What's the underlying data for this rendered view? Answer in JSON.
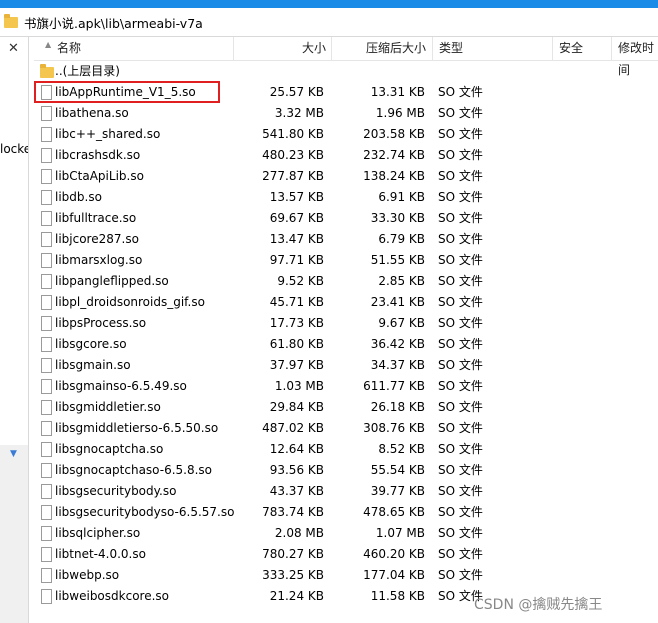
{
  "path": "书旗小说.apk\\lib\\armeabi-v7a",
  "left_pane": {
    "close_glyph": "✕",
    "clipped_text": "locke",
    "arrow": "▼"
  },
  "columns": {
    "name": "名称",
    "size": "大小",
    "compressed": "压缩后大小",
    "type": "类型",
    "security": "安全",
    "modified": "修改时间"
  },
  "parent_row": "..(上层目录)",
  "files": [
    {
      "name": "libAppRuntime_V1_5.so",
      "size": "25.57 KB",
      "compressed": "13.31 KB",
      "type": "SO 文件"
    },
    {
      "name": "libathena.so",
      "size": "3.32 MB",
      "compressed": "1.96 MB",
      "type": "SO 文件"
    },
    {
      "name": "libc++_shared.so",
      "size": "541.80 KB",
      "compressed": "203.58 KB",
      "type": "SO 文件"
    },
    {
      "name": "libcrashsdk.so",
      "size": "480.23 KB",
      "compressed": "232.74 KB",
      "type": "SO 文件"
    },
    {
      "name": "libCtaApiLib.so",
      "size": "277.87 KB",
      "compressed": "138.24 KB",
      "type": "SO 文件"
    },
    {
      "name": "libdb.so",
      "size": "13.57 KB",
      "compressed": "6.91 KB",
      "type": "SO 文件"
    },
    {
      "name": "libfulltrace.so",
      "size": "69.67 KB",
      "compressed": "33.30 KB",
      "type": "SO 文件"
    },
    {
      "name": "libjcore287.so",
      "size": "13.47 KB",
      "compressed": "6.79 KB",
      "type": "SO 文件"
    },
    {
      "name": "libmarsxlog.so",
      "size": "97.71 KB",
      "compressed": "51.55 KB",
      "type": "SO 文件"
    },
    {
      "name": "libpangleflipped.so",
      "size": "9.52 KB",
      "compressed": "2.85 KB",
      "type": "SO 文件"
    },
    {
      "name": "libpl_droidsonroids_gif.so",
      "size": "45.71 KB",
      "compressed": "23.41 KB",
      "type": "SO 文件"
    },
    {
      "name": "libpsProcess.so",
      "size": "17.73 KB",
      "compressed": "9.67 KB",
      "type": "SO 文件"
    },
    {
      "name": "libsgcore.so",
      "size": "61.80 KB",
      "compressed": "36.42 KB",
      "type": "SO 文件"
    },
    {
      "name": "libsgmain.so",
      "size": "37.97 KB",
      "compressed": "34.37 KB",
      "type": "SO 文件"
    },
    {
      "name": "libsgmainso-6.5.49.so",
      "size": "1.03 MB",
      "compressed": "611.77 KB",
      "type": "SO 文件"
    },
    {
      "name": "libsgmiddletier.so",
      "size": "29.84 KB",
      "compressed": "26.18 KB",
      "type": "SO 文件"
    },
    {
      "name": "libsgmiddletierso-6.5.50.so",
      "size": "487.02 KB",
      "compressed": "308.76 KB",
      "type": "SO 文件"
    },
    {
      "name": "libsgnocaptcha.so",
      "size": "12.64 KB",
      "compressed": "8.52 KB",
      "type": "SO 文件"
    },
    {
      "name": "libsgnocaptchaso-6.5.8.so",
      "size": "93.56 KB",
      "compressed": "55.54 KB",
      "type": "SO 文件"
    },
    {
      "name": "libsgsecuritybody.so",
      "size": "43.37 KB",
      "compressed": "39.77 KB",
      "type": "SO 文件"
    },
    {
      "name": "libsgsecuritybodyso-6.5.57.so",
      "size": "783.74 KB",
      "compressed": "478.65 KB",
      "type": "SO 文件"
    },
    {
      "name": "libsqlcipher.so",
      "size": "2.08 MB",
      "compressed": "1.07 MB",
      "type": "SO 文件"
    },
    {
      "name": "libtnet-4.0.0.so",
      "size": "780.27 KB",
      "compressed": "460.20 KB",
      "type": "SO 文件"
    },
    {
      "name": "libwebp.so",
      "size": "333.25 KB",
      "compressed": "177.04 KB",
      "type": "SO 文件"
    },
    {
      "name": "libweibosdkcore.so",
      "size": "21.24 KB",
      "compressed": "11.58 KB",
      "type": "SO 文件"
    }
  ],
  "watermark": "CSDN @擒贼先擒王",
  "colors": {
    "title_bar": "#1a8ce8",
    "highlight_border": "#e02020",
    "folder": "#f4c64d"
  }
}
